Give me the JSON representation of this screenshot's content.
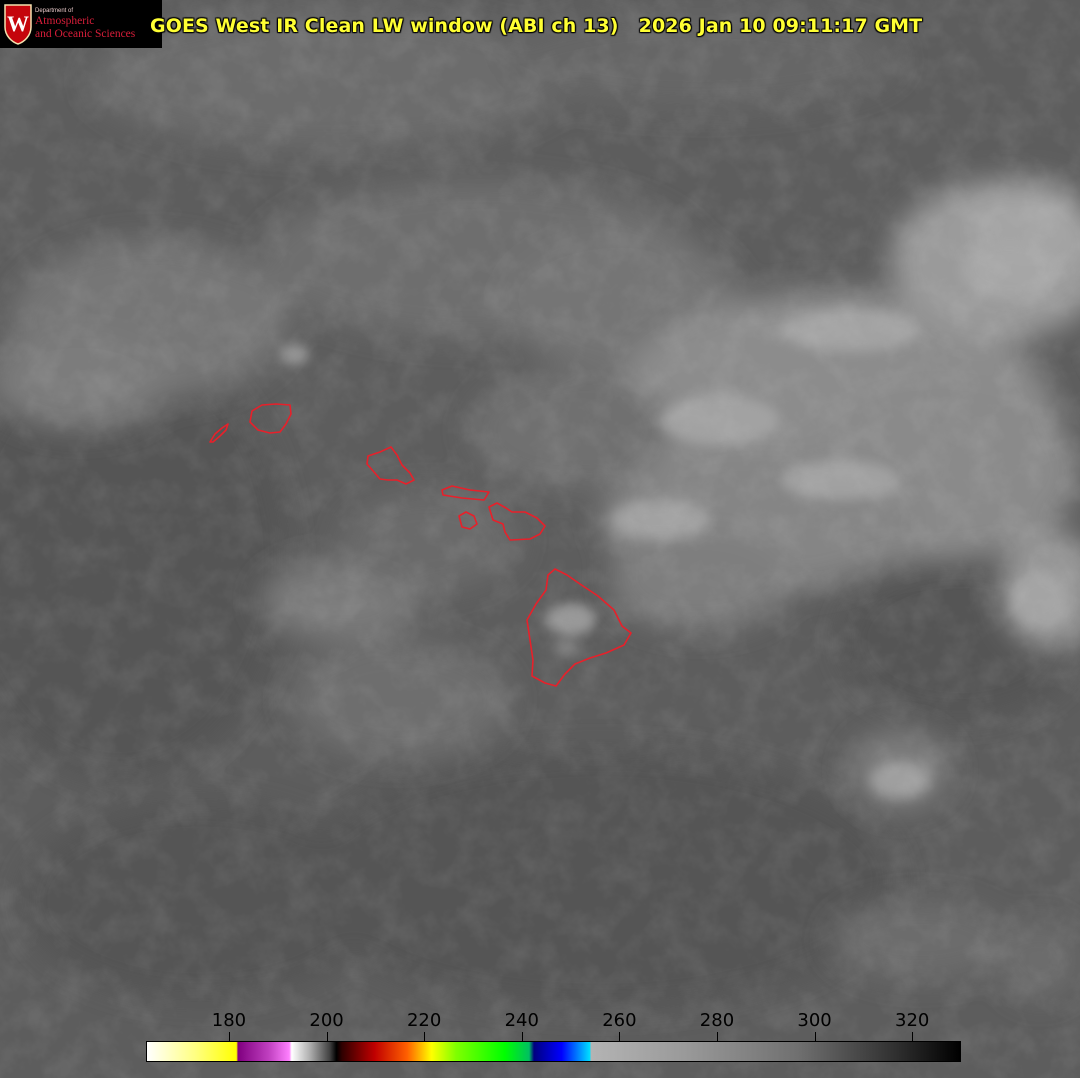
{
  "header": {
    "title": "GOES West IR Clean LW window (ABI ch 13)   2026 Jan 10 09:11:17 GMT"
  },
  "logo": {
    "crest_letter": "W",
    "department": "Department of",
    "name_line1": "Atmospheric",
    "name_line2": "and Oceanic Sciences"
  },
  "colorbar": {
    "labels": [
      "180",
      "200",
      "220",
      "240",
      "260",
      "280",
      "300",
      "320"
    ],
    "values": [
      180,
      200,
      220,
      240,
      260,
      280,
      300,
      320
    ],
    "range": [
      163,
      330
    ]
  },
  "colors": {
    "coastline": "#e8202a",
    "title": "#ffff33"
  }
}
